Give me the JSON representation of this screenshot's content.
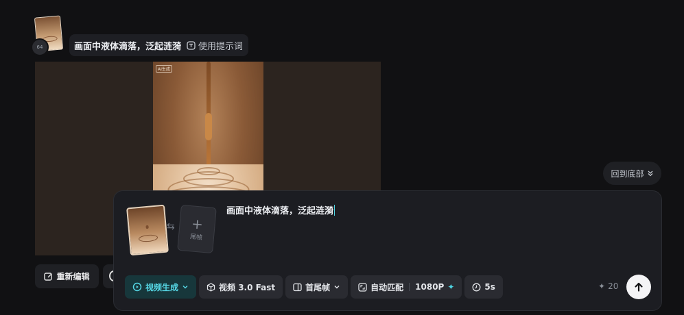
{
  "history": {
    "prompt_text": "画面中液体滴落，泛起涟漪",
    "use_prompt_label": "使用提示词",
    "thumb_badge": "64"
  },
  "preview": {
    "watermark": "AI生成"
  },
  "actions": {
    "reedit_label": "重新编辑"
  },
  "back_to_bottom_label": "回到底部",
  "composer": {
    "last_frame_label": "尾帧",
    "prompt_value": "画面中液体滴落，泛起涟漪",
    "toolbar": {
      "mode_label": "视频生成",
      "model_label": "视频 3.0 Fast",
      "frames_label": "首尾帧",
      "ratio_label": "自动匹配",
      "resolution_label": "1080P",
      "duration_label": "5s"
    },
    "credits": "20"
  },
  "colors": {
    "background": "#111113",
    "accent": "#4fd6e4",
    "active_button_bg": "#17373b"
  }
}
